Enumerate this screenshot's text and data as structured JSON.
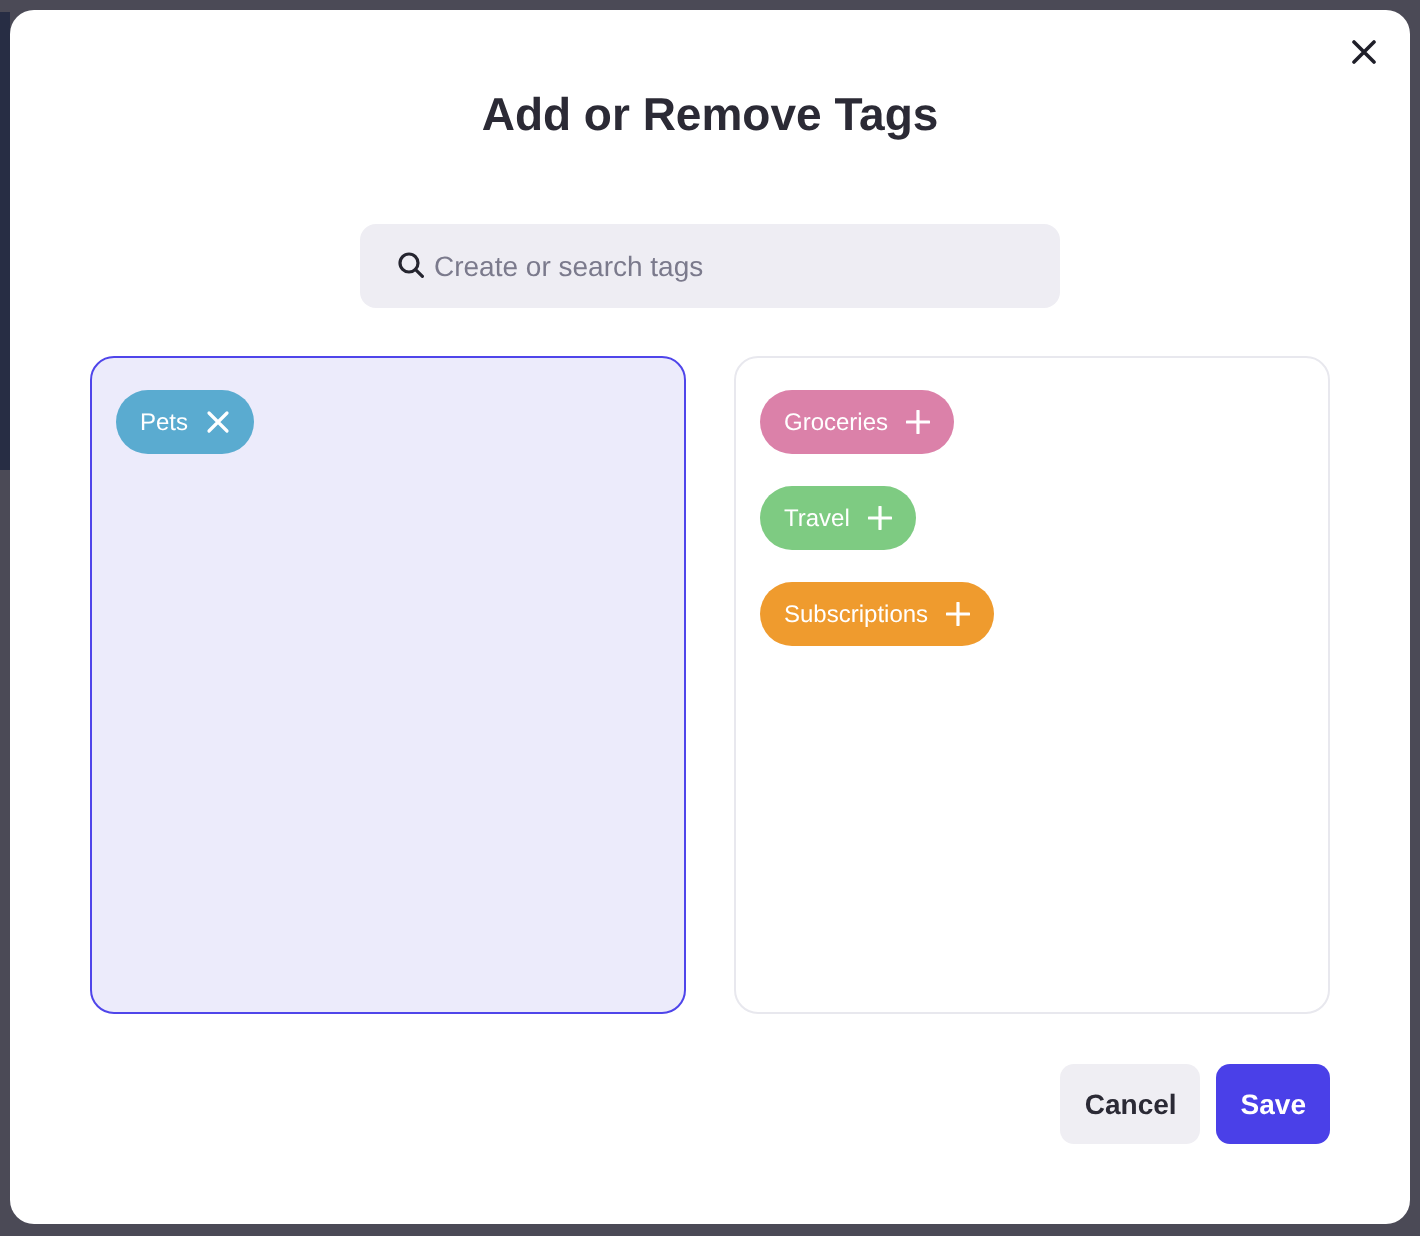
{
  "dialog": {
    "title": "Add or Remove Tags"
  },
  "search": {
    "placeholder": "Create or search tags"
  },
  "panels": [
    {
      "kind": "selected",
      "tags": [
        {
          "label": "Pets",
          "color": "#5aabd0"
        }
      ]
    },
    {
      "kind": "available",
      "tags": [
        {
          "label": "Groceries",
          "color": "#db81a9"
        },
        {
          "label": "Travel",
          "color": "#7ecb82"
        },
        {
          "label": "Subscriptions",
          "color": "#ef9b2e"
        }
      ]
    }
  ],
  "buttons": [
    {
      "label": "Cancel",
      "kind": "secondary"
    },
    {
      "label": "Save",
      "kind": "primary"
    }
  ]
}
